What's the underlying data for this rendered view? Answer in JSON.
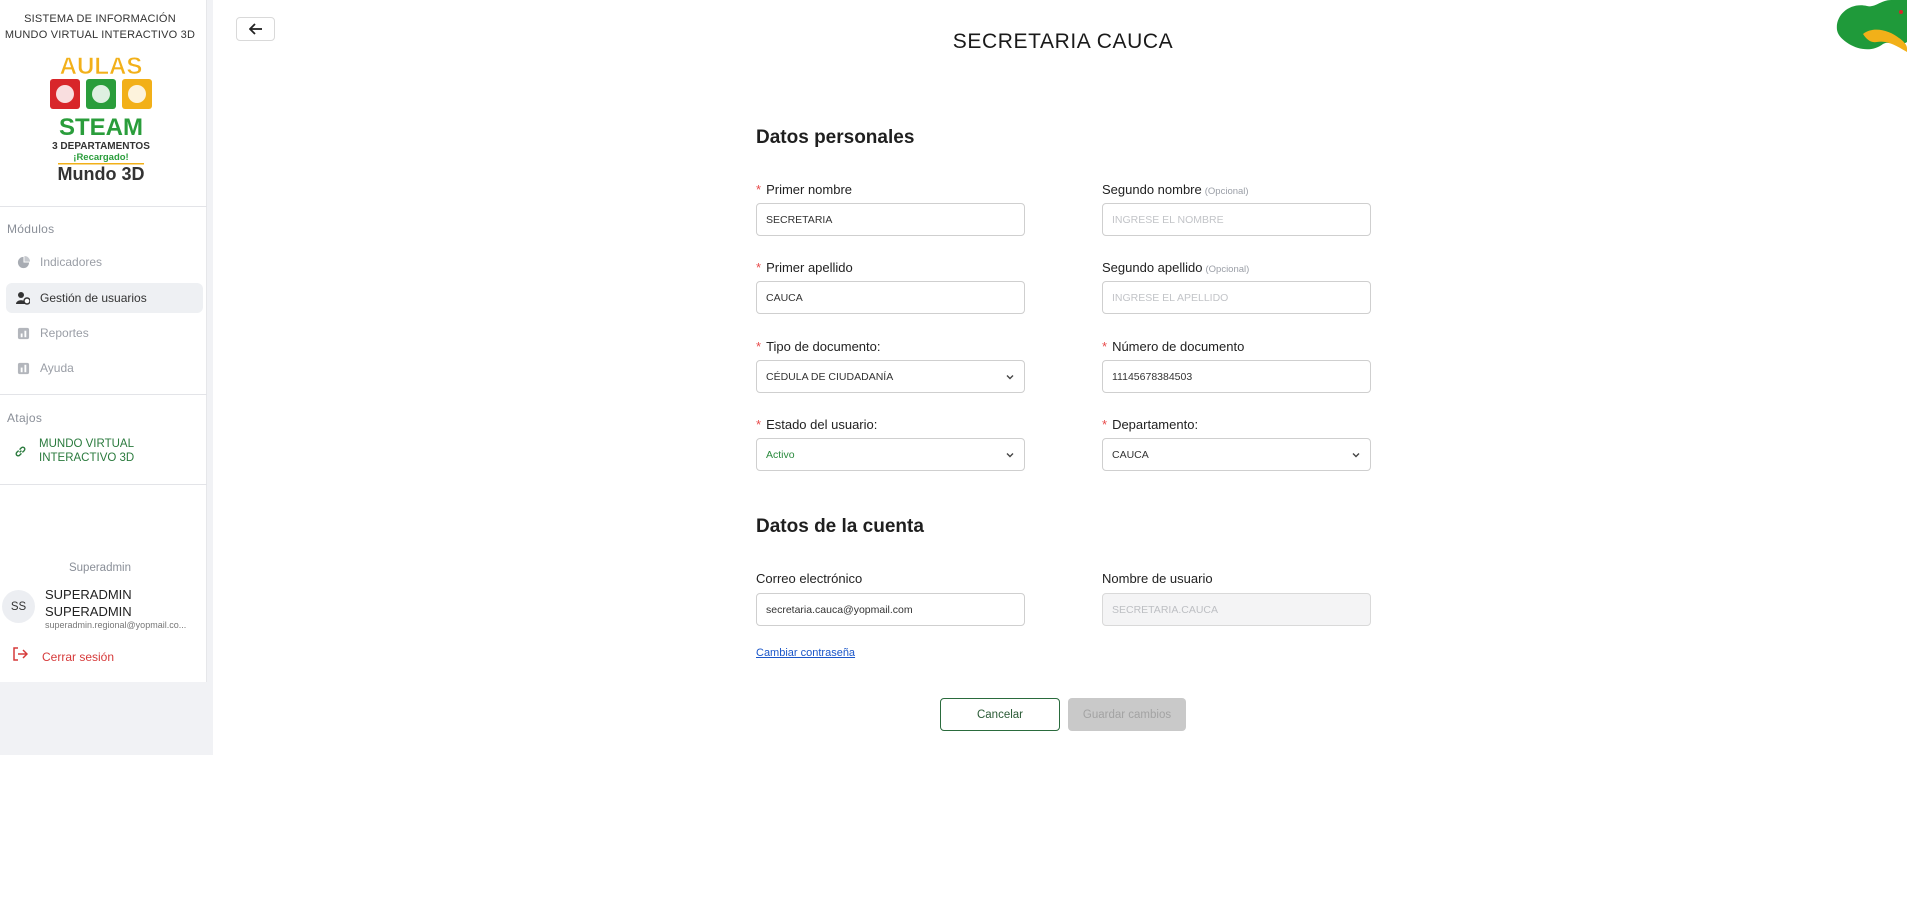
{
  "sidebar": {
    "system_title_line1": "SISTEMA DE INFORMACIÓN",
    "system_title_line2": "MUNDO VIRTUAL INTERACTIVO 3D",
    "logo": {
      "line1": "AULAS",
      "line2": "STEAM",
      "line3": "3 DEPARTAMENTOS",
      "line4": "¡Recargado!",
      "line5": "Mundo 3D"
    },
    "modules_label": "Módulos",
    "items": [
      {
        "label": "Indicadores",
        "icon": "pie-chart-icon",
        "active": false
      },
      {
        "label": "Gestión de usuarios",
        "icon": "user-gear-icon",
        "active": true
      },
      {
        "label": "Reportes",
        "icon": "report-icon",
        "active": false
      },
      {
        "label": "Ayuda",
        "icon": "help-icon",
        "active": false
      }
    ],
    "shortcuts_label": "Atajos",
    "shortcut": {
      "label_line1": "MUNDO VIRTUAL",
      "label_line2": "INTERACTIVO 3D",
      "icon": "link-icon"
    },
    "role": "Superadmin",
    "user": {
      "initials": "SS",
      "name_line1": "SUPERADMIN",
      "name_line2": "SUPERADMIN",
      "email": "superadmin.regional@yopmail.co..."
    },
    "logout_label": "Cerrar sesión"
  },
  "header": {
    "title": "SECRETARIA CAUCA"
  },
  "personal": {
    "title": "Datos personales",
    "first_name": {
      "label": "Primer nombre",
      "value": "SECRETARIA"
    },
    "second_name": {
      "label": "Segundo nombre",
      "optional": "(Opcional)",
      "placeholder": "INGRESE EL NOMBRE"
    },
    "first_lastname": {
      "label": "Primer apellido",
      "value": "CAUCA"
    },
    "second_lastname": {
      "label": "Segundo apellido",
      "optional": "(Opcional)",
      "placeholder": "INGRESE EL APELLIDO"
    },
    "doc_type": {
      "label": "Tipo de documento",
      "value": "CÉDULA DE CIUDADANÍA"
    },
    "doc_number": {
      "label": "Número de documento",
      "value": "11145678384503"
    },
    "status": {
      "label": "Estado del usuario",
      "value": "Activo"
    },
    "department": {
      "label": "Departamento",
      "value": "CAUCA"
    }
  },
  "account": {
    "title": "Datos de la cuenta",
    "email": {
      "label": "Correo electrónico",
      "value": "secretaria.cauca@yopmail.com"
    },
    "username": {
      "label": "Nombre de usuario",
      "value": "SECRETARIA.CAUCA"
    },
    "change_password": "Cambiar contraseña"
  },
  "actions": {
    "cancel": "Cancelar",
    "save": "Guardar cambios"
  },
  "colors": {
    "accent_green": "#2a6b3d",
    "required_red": "#e84a4a",
    "link_blue": "#1a56c9"
  }
}
